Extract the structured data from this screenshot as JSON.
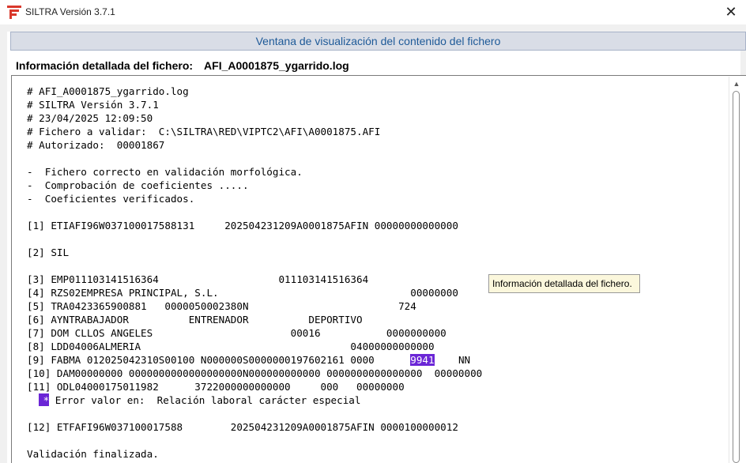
{
  "window": {
    "title": "SILTRA Versión 3.7.1",
    "close_glyph": "✕",
    "app_icon": "siltra-logo-icon"
  },
  "header": {
    "title": "Ventana de visualización del contenido del fichero"
  },
  "detail": {
    "label": "Información detallada del fichero:",
    "filename": "AFI_A0001875_ygarrido.log"
  },
  "log": {
    "lines": [
      "# AFI_A0001875_ygarrido.log",
      "# SILTRA Versión 3.7.1",
      "# 23/04/2025 12:09:50",
      "# Fichero a validar:  C:\\SILTRA\\RED\\VIPTC2\\AFI\\A0001875.AFI",
      "# Autorizado:  00001867",
      "",
      "-  Fichero correcto en validación morfológica.",
      "-  Comprobación de coeficientes .....",
      "-  Coeficientes verificados.",
      "",
      "[1] ETIAFI96W037100017588131     202504231209A0001875AFIN 00000000000000",
      "",
      "[2] SIL",
      "",
      "[3] EMP011103141516364                    011103141516364",
      "[4] RZS02EMPRESA PRINCIPAL, S.L.                                00000000",
      "[5] TRA0423365900881   0000050002380N                         724",
      "[6] AYNTRABAJADOR          ENTRENADOR          DEPORTIVO",
      "[7] DOM CLLOS ANGELES                       00016           0000000000",
      "[8] LDD04006ALMERIA                                   04000000000000"
    ],
    "line9_prefix": "[9] FABMA 012025042310S00100 N000000S0000000197602161 0000      ",
    "line9_highlight": "9941",
    "line9_suffix": "    NN",
    "line10": "[10] DAM00000000 0000000000000000000N000000000000 0000000000000000  00000000",
    "line11": "[11] ODL04000175011982      3722000000000000     000   00000000",
    "error_mark": "*",
    "error_text": " Error valor en:  Relación laboral carácter especial",
    "line_blank": "",
    "line12": "[12] ETFAFI96W037100017588        202504231209A0001875AFIN 0000100000012",
    "final": "Validación finalizada."
  },
  "tooltip": {
    "text": "Información detallada del fichero."
  },
  "scrollbar": {
    "up_glyph": "▲"
  },
  "colors": {
    "highlight": "#6b26d6",
    "header_text": "#1e5a98",
    "header_bg": "#d9dde6",
    "tooltip_bg": "#fbf7dc",
    "logo": "#d9382b"
  }
}
